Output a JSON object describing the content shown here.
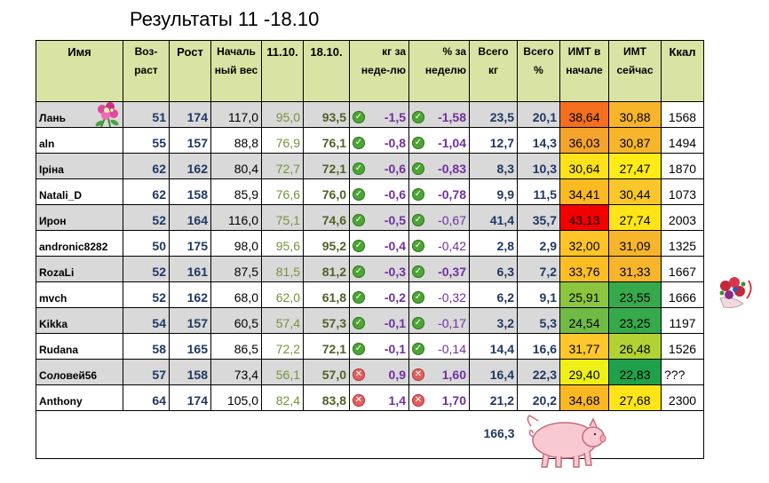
{
  "title": "Результаты  11 -18.10",
  "headers": {
    "name": "Имя",
    "age": "Воз-раст",
    "height": "Рост",
    "start_weight": "Началь ный вес",
    "date1": "11.10.",
    "date2": "18.10.",
    "kg_week": "кг за неде-лю",
    "pct_week": "% за неделю",
    "total_kg": "Всего кг",
    "total_pct": "Всего %",
    "bmi_start": "ИМТ в начале",
    "bmi_now": "ИМТ сейчас",
    "kcal": "Ккал"
  },
  "rows": [
    {
      "name": "Лань",
      "age": "51",
      "height": "174",
      "start": "117,0",
      "d1": "95,0",
      "d2": "93,5",
      "status": "ok",
      "kg": "-1,5",
      "pct": "-1,58",
      "total_kg": "23,5",
      "total_pct": "20,1",
      "bmi_start": "38,64",
      "bmi_now": "30,88",
      "kcal": "1568",
      "bmi_start_color": "#f36f1f",
      "bmi_now_color": "#f7b52c"
    },
    {
      "name": "aln",
      "age": "55",
      "height": "157",
      "start": "88,8",
      "d1": "76,9",
      "d2": "76,1",
      "status": "ok",
      "kg": "-0,8",
      "pct": "-1,04",
      "total_kg": "12,7",
      "total_pct": "14,3",
      "bmi_start": "36,03",
      "bmi_now": "30,87",
      "kcal": "1494",
      "bmi_start_color": "#f4a32c",
      "bmi_now_color": "#f7b52c"
    },
    {
      "name": "Іріна",
      "age": "62",
      "height": "162",
      "start": "80,4",
      "d1": "72,7",
      "d2": "72,1",
      "status": "ok",
      "kg": "-0,6",
      "pct": "-0,83",
      "total_kg": "8,3",
      "total_pct": "10,3",
      "bmi_start": "30,64",
      "bmi_now": "27,47",
      "kcal": "1870",
      "bmi_start_color": "#ffe31a",
      "bmi_now_color": "#ffeb16"
    },
    {
      "name": "Natali_D",
      "age": "62",
      "height": "158",
      "start": "85,9",
      "d1": "76,6",
      "d2": "76,0",
      "status": "ok",
      "kg": "-0,6",
      "pct": "-0,78",
      "total_kg": "9,9",
      "total_pct": "11,5",
      "bmi_start": "34,41",
      "bmi_now": "30,44",
      "kcal": "1073",
      "bmi_start_color": "#fbba21",
      "bmi_now_color": "#f9c729"
    },
    {
      "name": "Ирон",
      "age": "52",
      "height": "164",
      "start": "116,0",
      "d1": "75,1",
      "d2": "74,6",
      "status": "ok",
      "kg": "-0,5",
      "pct": "-0,67",
      "total_kg": "41,4",
      "total_pct": "35,7",
      "bmi_start": "43,13",
      "bmi_now": "27,74",
      "kcal": "2003",
      "bmi_start_color": "#f20000",
      "bmi_now_color": "#ffe518"
    },
    {
      "name": "andronic8282",
      "age": "50",
      "height": "175",
      "start": "98,0",
      "d1": "95,6",
      "d2": "95,2",
      "status": "ok",
      "kg": "-0,4",
      "pct": "-0,42",
      "total_kg": "2,8",
      "total_pct": "2,9",
      "bmi_start": "32,00",
      "bmi_now": "31,09",
      "kcal": "1325",
      "bmi_start_color": "#fec428",
      "bmi_now_color": "#f7b52c"
    },
    {
      "name": "RozaLi",
      "age": "52",
      "height": "161",
      "start": "87,5",
      "d1": "81,5",
      "d2": "81,2",
      "status": "ok",
      "kg": "-0,3",
      "pct": "-0,37",
      "total_kg": "6,3",
      "total_pct": "7,2",
      "bmi_start": "33,76",
      "bmi_now": "31,33",
      "kcal": "1667",
      "bmi_start_color": "#fcbe22",
      "bmi_now_color": "#f7b52c"
    },
    {
      "name": "mvch",
      "age": "52",
      "height": "162",
      "start": "68,0",
      "d1": "62,0",
      "d2": "61,8",
      "status": "ok",
      "kg": "-0,2",
      "pct": "-0,32",
      "total_kg": "6,2",
      "total_pct": "9,1",
      "bmi_start": "25,91",
      "bmi_now": "23,55",
      "kcal": "1666",
      "bmi_start_color": "#8cc63e",
      "bmi_now_color": "#36a94b"
    },
    {
      "name": "Kikka",
      "age": "54",
      "height": "157",
      "start": "60,5",
      "d1": "57,4",
      "d2": "57,3",
      "status": "ok",
      "kg": "-0,1",
      "pct": "-0,17",
      "total_kg": "3,2",
      "total_pct": "5,3",
      "bmi_start": "24,54",
      "bmi_now": "23,25",
      "kcal": "1197",
      "bmi_start_color": "#6fbb45",
      "bmi_now_color": "#36a94b"
    },
    {
      "name": "Rudana",
      "age": "58",
      "height": "165",
      "start": "86,5",
      "d1": "72,2",
      "d2": "72,1",
      "status": "ok",
      "kg": "-0,1",
      "pct": "-0,14",
      "total_kg": "14,4",
      "total_pct": "16,6",
      "bmi_start": "31,77",
      "bmi_now": "26,48",
      "kcal": "1526",
      "bmi_start_color": "#ffc72a",
      "bmi_now_color": "#b2d234"
    },
    {
      "name": "Соловей56",
      "age": "57",
      "height": "158",
      "start": "73,4",
      "d1": "56,1",
      "d2": "57,0",
      "status": "bad",
      "kg": "0,9",
      "pct": "1,60",
      "total_kg": "16,4",
      "total_pct": "22,3",
      "bmi_start": "29,40",
      "bmi_now": "22,83",
      "kcal": "???",
      "bmi_start_color": "#eef018",
      "bmi_now_color": "#1fa04a"
    },
    {
      "name": "Anthony",
      "age": "64",
      "height": "174",
      "start": "105,0",
      "d1": "82,4",
      "d2": "83,8",
      "status": "bad",
      "kg": "1,4",
      "pct": "1,70",
      "total_kg": "21,2",
      "total_pct": "20,2",
      "bmi_start": "34,68",
      "bmi_now": "27,68",
      "kcal": "2300",
      "bmi_start_color": "#fbb823",
      "bmi_now_color": "#ffe518"
    }
  ],
  "total": "166,3",
  "icons": {
    "ok": "check-circle-icon",
    "bad": "cross-circle-icon"
  },
  "colors": {
    "header_bg": "#d9e4a4",
    "gray_row": "#d9d9d9",
    "navy_text": "#1f3864",
    "olive_text": "#76923c",
    "purple_text": "#7030a0",
    "ok_icon": "#4ea435",
    "bad_icon": "#e26060"
  }
}
